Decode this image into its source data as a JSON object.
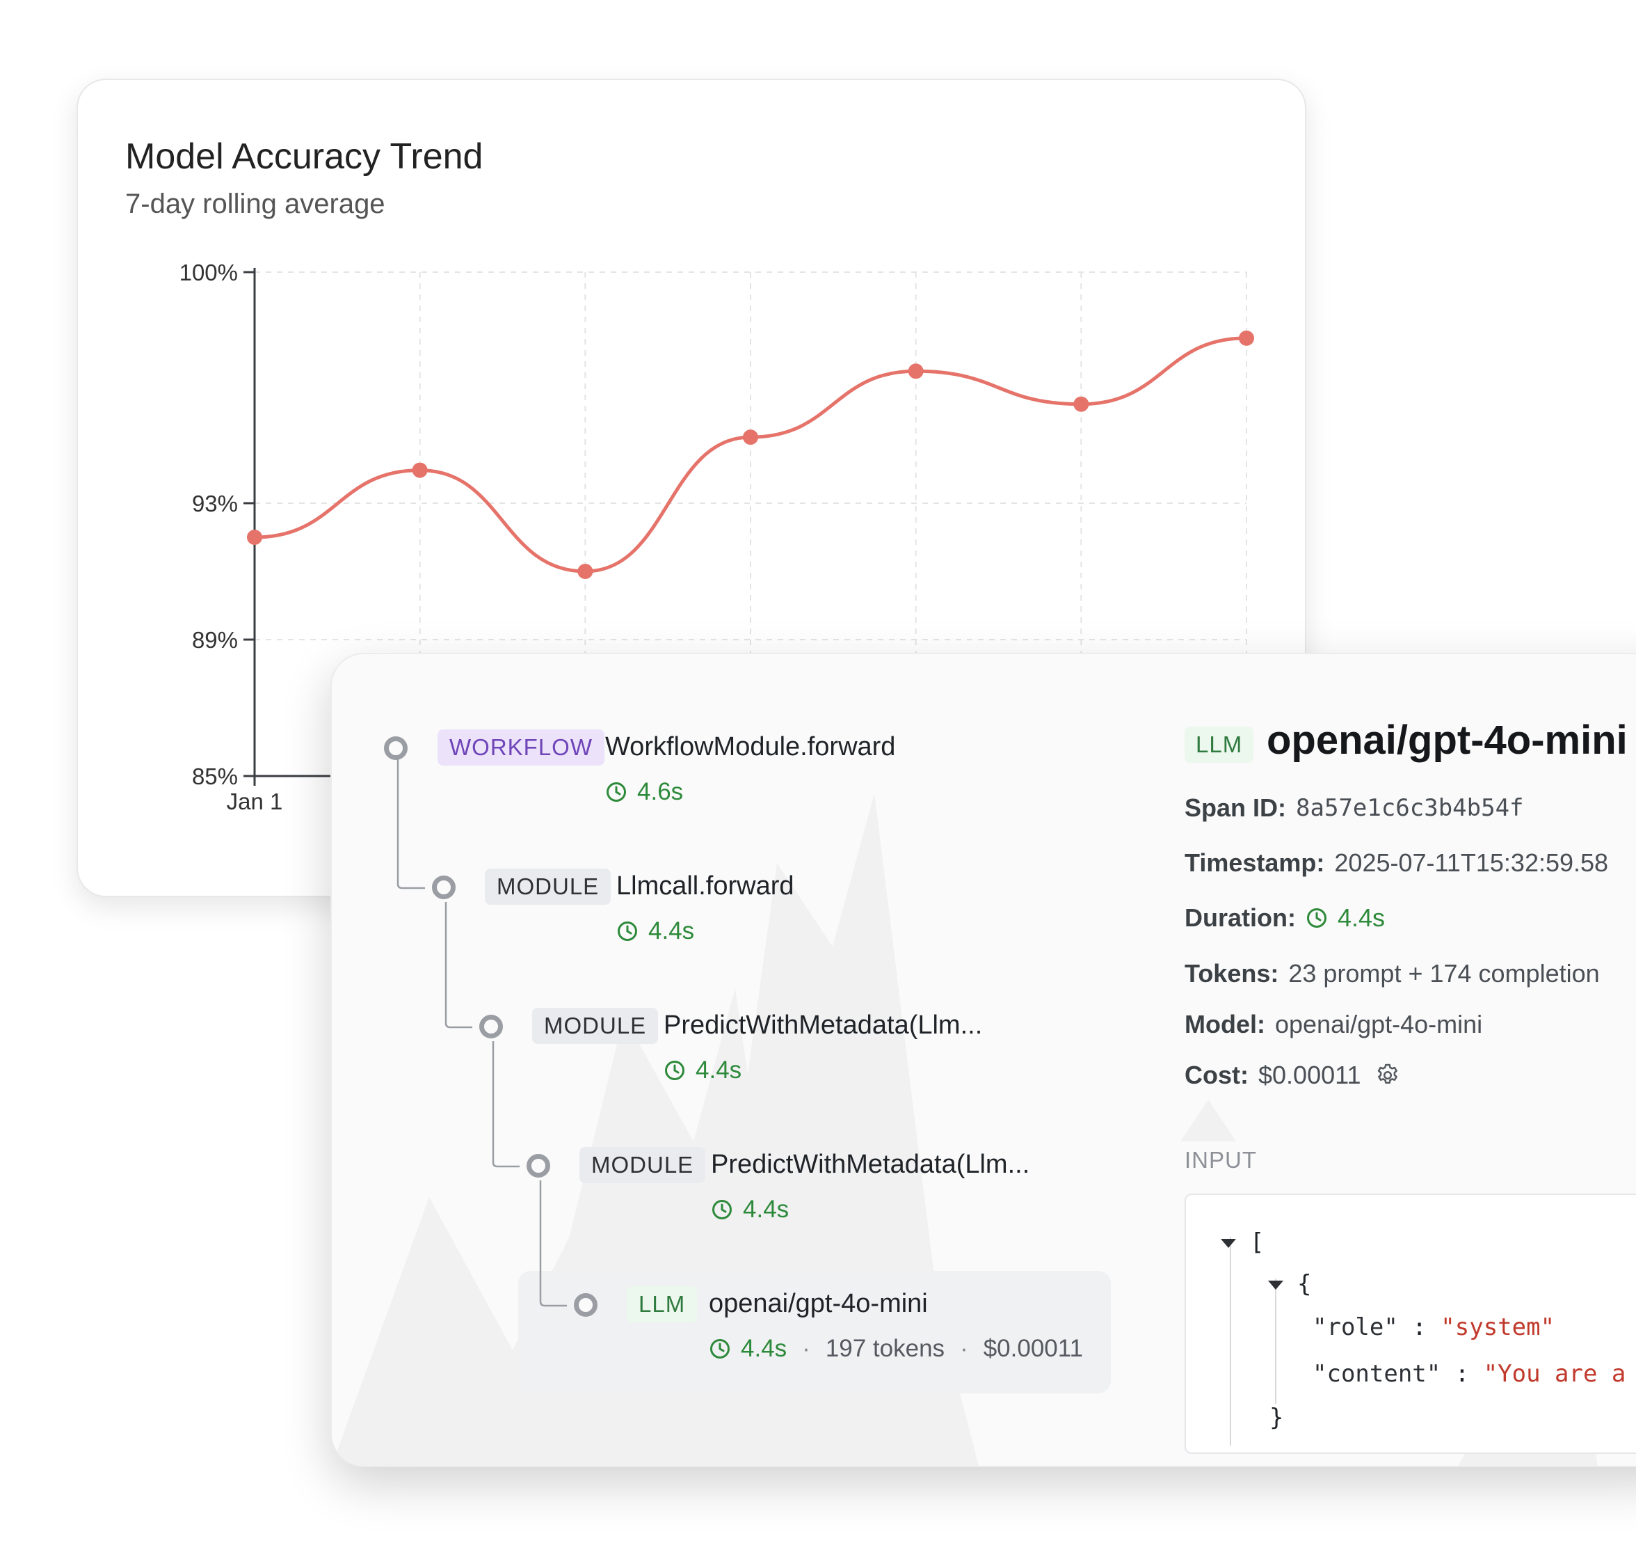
{
  "chart_card": {
    "title": "Model Accuracy Trend",
    "subtitle": "7-day rolling average"
  },
  "chart_data": {
    "type": "line",
    "title": "Model Accuracy Trend",
    "subtitle": "7-day rolling average",
    "y_ticks": [
      "100%",
      "93%",
      "89%",
      "85%"
    ],
    "x_ticks_visible": [
      "Jan 1"
    ],
    "ylim": [
      85,
      100
    ],
    "grid": true,
    "series": [
      {
        "color": "#e5736a",
        "values": [
          92.0,
          94.0,
          91.0,
          95.0,
          97.0,
          96.0,
          98.0
        ]
      }
    ]
  },
  "trace": {
    "nodes": [
      {
        "type": "WORKFLOW",
        "name": "WorkflowModule.forward",
        "duration": "4.6s"
      },
      {
        "type": "MODULE",
        "name": "Llmcall.forward",
        "duration": "4.4s"
      },
      {
        "type": "MODULE",
        "name": "PredictWithMetadata(Llm...",
        "duration": "4.4s"
      },
      {
        "type": "MODULE",
        "name": "PredictWithMetadata(Llm...",
        "duration": "4.4s"
      },
      {
        "type": "LLM",
        "name": "openai/gpt-4o-mini",
        "duration": "4.4s",
        "tokens": "197 tokens",
        "cost": "$0.00011",
        "sep": "·",
        "selected": true
      }
    ]
  },
  "detail": {
    "badge": "LLM",
    "title": "openai/gpt-4o-mini",
    "span_id_label": "Span ID:",
    "span_id": "8a57e1c6c3b4b54f",
    "timestamp_label": "Timestamp:",
    "timestamp": "2025-07-11T15:32:59.58",
    "duration_label": "Duration:",
    "duration": "4.4s",
    "tokens_label": "Tokens:",
    "tokens": "23 prompt + 174 completion",
    "model_label": "Model:",
    "model": "openai/gpt-4o-mini",
    "cost_label": "Cost:",
    "cost": "$0.00011",
    "input_label": "INPUT",
    "json": {
      "open_bracket": "[",
      "open_brace": "{",
      "role_key": "\"role\"",
      "colon": ":",
      "role_value": "\"system\"",
      "content_key": "\"content\"",
      "content_value": "\"You are a",
      "close_brace": "}"
    }
  },
  "colors": {
    "line": "#e5736a",
    "duration_green": "#2d8a3a",
    "workflow_badge": "#ece3fb",
    "module_badge": "#e9ebee",
    "llm_badge": "#ecf7ee"
  }
}
